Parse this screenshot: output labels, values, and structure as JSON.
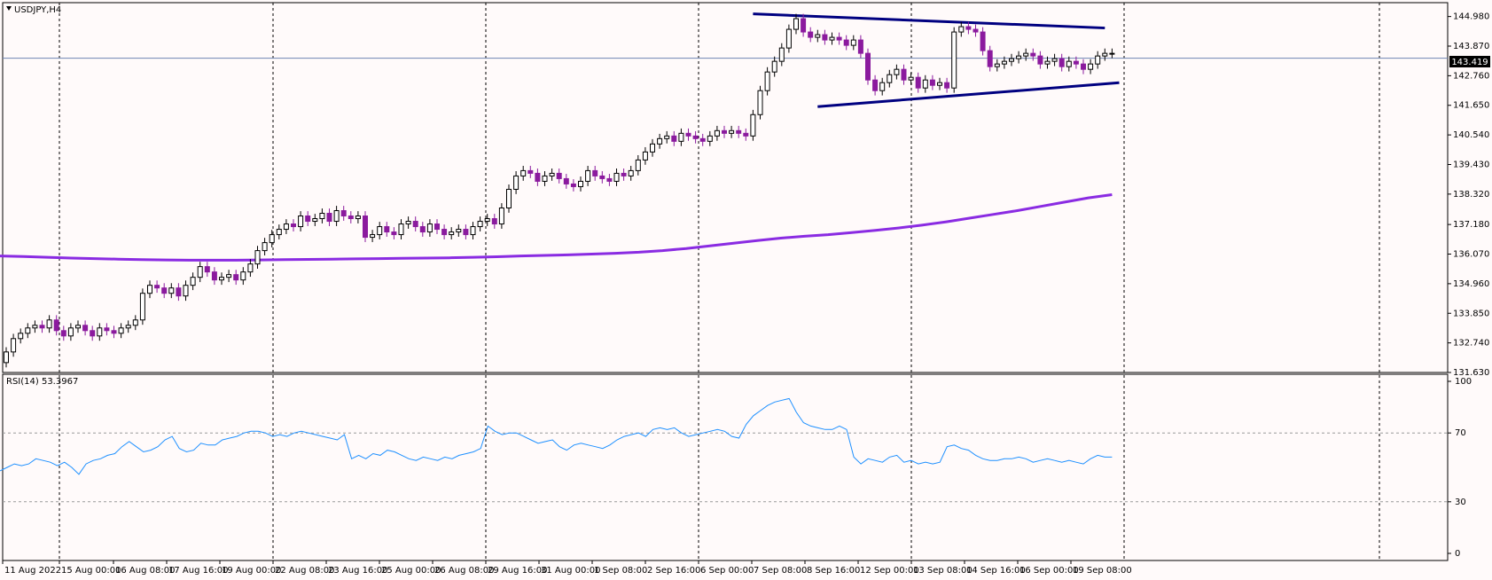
{
  "symbol_label": "USDJPY,H4",
  "rsi_label": "RSI(14) 53.3967",
  "current_price_label": "143.419",
  "colors": {
    "background": "#fffafa",
    "bull_candle": "#ffffff",
    "bear_candle": "#8b1a9e",
    "ma_line": "#8a2be2",
    "trendline": "#000080",
    "rsi_line": "#1e90ff",
    "price_line": "#6f86b3"
  },
  "chart_data": [
    {
      "type": "candlestick",
      "title": "USDJPY,H4",
      "ylim": [
        131.63,
        145.5
      ],
      "y_ticks": [
        "144.980",
        "143.870",
        "142.760",
        "141.650",
        "140.540",
        "139.430",
        "138.320",
        "137.180",
        "136.070",
        "134.960",
        "133.850",
        "132.740",
        "131.630"
      ],
      "x_ticks": [
        "11 Aug 2022",
        "15 Aug 00:00",
        "16 Aug 08:00",
        "17 Aug 16:00",
        "19 Aug 00:00",
        "22 Aug 08:00",
        "23 Aug 16:00",
        "25 Aug 00:00",
        "26 Aug 08:00",
        "29 Aug 16:00",
        "31 Aug 00:00",
        "1 Sep 08:00",
        "2 Sep 16:00",
        "6 Sep 00:00",
        "7 Sep 08:00",
        "8 Sep 16:00",
        "12 Sep 00:00",
        "13 Sep 08:00",
        "14 Sep 16:00",
        "16 Sep 00:00",
        "19 Sep 08:00"
      ],
      "current_price": 143.419,
      "close": [
        132.4,
        132.9,
        133.1,
        133.3,
        133.4,
        133.3,
        133.6,
        133.2,
        133.0,
        133.3,
        133.4,
        133.2,
        133.0,
        133.3,
        133.2,
        133.1,
        133.3,
        133.4,
        133.6,
        134.6,
        134.9,
        134.8,
        134.6,
        134.8,
        134.5,
        134.9,
        135.2,
        135.6,
        135.4,
        135.1,
        135.2,
        135.3,
        135.1,
        135.4,
        135.7,
        136.2,
        136.5,
        136.8,
        137.0,
        137.2,
        137.1,
        137.5,
        137.3,
        137.4,
        137.6,
        137.3,
        137.7,
        137.5,
        137.4,
        137.5,
        136.7,
        136.8,
        137.1,
        136.9,
        136.8,
        137.2,
        137.3,
        137.1,
        136.9,
        137.2,
        137.0,
        136.8,
        136.9,
        137.0,
        136.8,
        137.1,
        137.3,
        137.4,
        137.2,
        137.8,
        138.5,
        139.0,
        139.2,
        139.1,
        138.8,
        139.0,
        139.1,
        138.9,
        138.7,
        138.6,
        138.8,
        139.2,
        139.0,
        138.9,
        138.8,
        139.1,
        139.0,
        139.2,
        139.6,
        139.9,
        140.2,
        140.4,
        140.5,
        140.3,
        140.6,
        140.5,
        140.4,
        140.3,
        140.5,
        140.7,
        140.6,
        140.7,
        140.6,
        140.5,
        141.3,
        142.2,
        142.9,
        143.3,
        143.8,
        144.5,
        144.9,
        144.4,
        144.2,
        144.3,
        144.1,
        144.2,
        144.1,
        143.9,
        144.1,
        143.6,
        142.6,
        142.2,
        142.5,
        142.8,
        143.0,
        142.6,
        142.7,
        142.3,
        142.6,
        142.4,
        142.5,
        142.3,
        144.4,
        144.6,
        144.5,
        144.4,
        143.7,
        143.1,
        143.2,
        143.3,
        143.4,
        143.5,
        143.6,
        143.5,
        143.2,
        143.3,
        143.4,
        143.1,
        143.3,
        143.2,
        143.0,
        143.2,
        143.5,
        143.6,
        143.6
      ],
      "series": [
        {
          "name": "",
          "type": "line",
          "values": [
            136.0,
            135.98,
            135.95,
            135.92,
            135.9,
            135.88,
            135.86,
            135.85,
            135.84,
            135.84,
            135.84,
            135.85,
            135.86,
            135.87,
            135.88,
            135.89,
            135.9,
            135.91,
            135.92,
            135.93,
            135.95,
            135.97,
            136.0,
            136.02,
            136.04,
            136.07,
            136.1,
            136.14,
            136.2,
            136.28,
            136.38,
            136.48,
            136.58,
            136.67,
            136.74,
            136.8,
            136.88,
            136.96,
            137.05,
            137.16,
            137.28,
            137.42,
            137.56,
            137.7,
            137.86,
            138.02,
            138.18,
            138.3
          ]
        },
        {
          "name": "",
          "type": "trendline",
          "values": [
            145.08,
            144.55
          ]
        },
        {
          "name": "",
          "type": "trendline",
          "values": [
            141.6,
            142.5
          ]
        }
      ]
    },
    {
      "type": "line",
      "title": "RSI(14) 53.3967",
      "ylim": [
        0,
        100
      ],
      "y_ticks": [
        "100",
        "70",
        "30",
        "0"
      ],
      "series": [
        {
          "name": "",
          "values": [
            48,
            50,
            52,
            51,
            52,
            55,
            54,
            53,
            51,
            53,
            50,
            46,
            52,
            54,
            55,
            57,
            58,
            62,
            65,
            62,
            59,
            60,
            62,
            66,
            68,
            61,
            59,
            60,
            64,
            63,
            63,
            66,
            67,
            68,
            70,
            71,
            71,
            70,
            68,
            69,
            68,
            70,
            71,
            70,
            69,
            68,
            67,
            66,
            69,
            55,
            57,
            55,
            58,
            57,
            60,
            59,
            57,
            55,
            54,
            56,
            55,
            54,
            56,
            55,
            57,
            58,
            59,
            61,
            74,
            71,
            69,
            70,
            70,
            68,
            66,
            64,
            65,
            66,
            62,
            60,
            63,
            64,
            63,
            62,
            61,
            63,
            66,
            68,
            69,
            70,
            68,
            72,
            73,
            72,
            73,
            70,
            68,
            69,
            70,
            71,
            72,
            71,
            68,
            67,
            75,
            80,
            83,
            86,
            88,
            89,
            90,
            82,
            76,
            74,
            73,
            72,
            72,
            74,
            72,
            56,
            52,
            55,
            54,
            53,
            56,
            57,
            53,
            54,
            52,
            53,
            52,
            53,
            62,
            63,
            61,
            60,
            57,
            55,
            54,
            54,
            55,
            55,
            56,
            55,
            53,
            54,
            55,
            54,
            53,
            54,
            53,
            52,
            55,
            57,
            56,
            56
          ]
        }
      ]
    }
  ]
}
